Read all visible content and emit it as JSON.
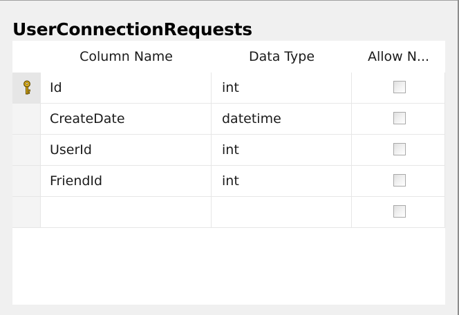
{
  "table": {
    "title": "UserConnectionRequests",
    "columns": {
      "column_name": "Column Name",
      "data_type": "Data Type",
      "allow_nulls": "Allow N..."
    },
    "rows": [
      {
        "name": "Id",
        "type": "int",
        "allow_nulls": false,
        "primary_key": true
      },
      {
        "name": "CreateDate",
        "type": "datetime",
        "allow_nulls": false,
        "primary_key": false
      },
      {
        "name": "UserId",
        "type": "int",
        "allow_nulls": false,
        "primary_key": false
      },
      {
        "name": "FriendId",
        "type": "int",
        "allow_nulls": false,
        "primary_key": false
      },
      {
        "name": "",
        "type": "",
        "allow_nulls": false,
        "primary_key": false
      }
    ],
    "icons": {
      "primary_key": "key-icon"
    },
    "colors": {
      "key_gold": "#d4a017",
      "grid_line": "#e6e6e6",
      "background": "#f0f0f0"
    }
  }
}
